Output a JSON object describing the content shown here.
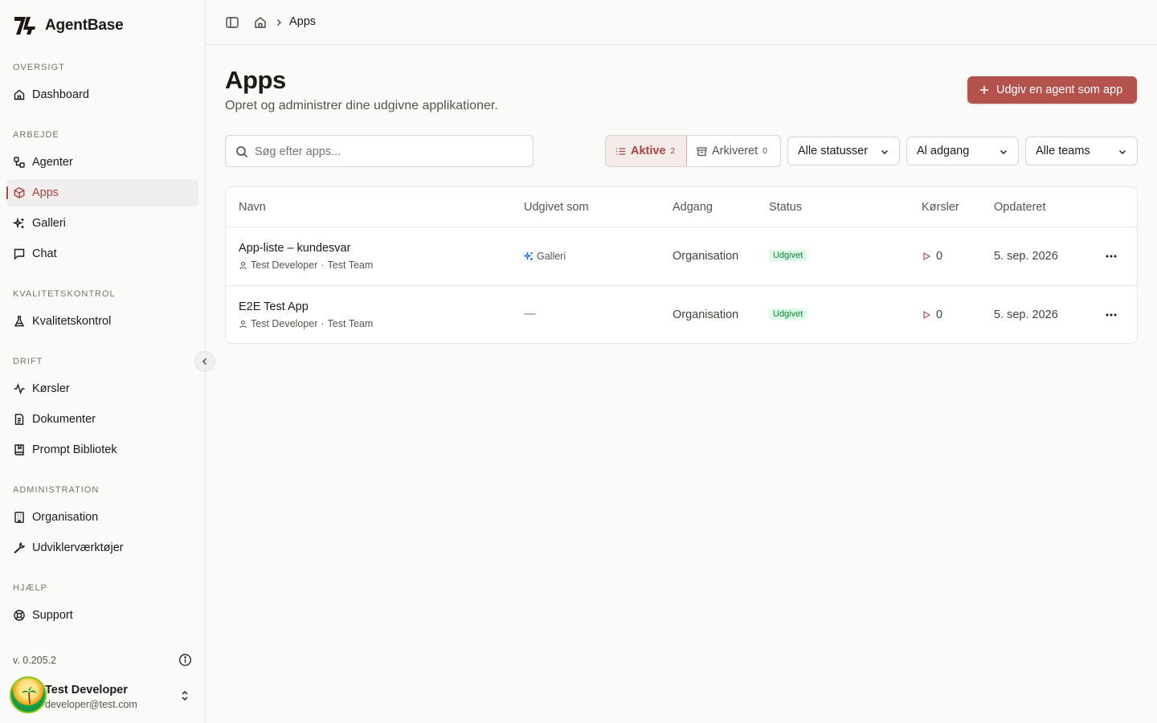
{
  "brand": {
    "name": "AgentBase"
  },
  "sidebar": {
    "sections": [
      {
        "label": "OVERSIGT",
        "items": [
          {
            "label": "Dashboard",
            "icon": "home-icon"
          }
        ]
      },
      {
        "label": "ARBEJDE",
        "items": [
          {
            "label": "Agenter",
            "icon": "workflow-icon"
          },
          {
            "label": "Apps",
            "icon": "box-icon",
            "active": true
          },
          {
            "label": "Galleri",
            "icon": "sparkles-icon"
          },
          {
            "label": "Chat",
            "icon": "message-icon"
          }
        ]
      },
      {
        "label": "KVALITETSKONTROL",
        "items": [
          {
            "label": "Kvalitetskontrol",
            "icon": "flask-icon"
          }
        ]
      },
      {
        "label": "DRIFT",
        "items": [
          {
            "label": "Kørsler",
            "icon": "activity-icon"
          },
          {
            "label": "Dokumenter",
            "icon": "document-icon"
          },
          {
            "label": "Prompt Bibliotek",
            "icon": "book-icon"
          }
        ]
      },
      {
        "label": "ADMINISTRATION",
        "items": [
          {
            "label": "Organisation",
            "icon": "building-icon"
          },
          {
            "label": "Udviklerværktøjer",
            "icon": "wrench-icon"
          }
        ]
      },
      {
        "label": "HJÆLP",
        "items": [
          {
            "label": "Support",
            "icon": "lifebuoy-icon"
          }
        ]
      }
    ],
    "version": "v. 0.205.2",
    "user": {
      "name": "Test Developer",
      "email": "developer@test.com"
    }
  },
  "breadcrumb": {
    "current": "Apps"
  },
  "page": {
    "title": "Apps",
    "subtitle": "Opret og administrer dine udgivne applikationer.",
    "primary_action": "Udgiv en agent som app"
  },
  "filters": {
    "search_placeholder": "Søg efter apps...",
    "tabs": [
      {
        "label": "Aktive",
        "count": "2",
        "selected": true
      },
      {
        "label": "Arkiveret",
        "count": "0",
        "selected": false
      }
    ],
    "status": "Alle statusser",
    "access": "Al adgang",
    "teams": "Alle teams"
  },
  "table": {
    "headers": [
      "Navn",
      "Udgivet som",
      "Adgang",
      "Status",
      "Kørsler",
      "Opdateret"
    ],
    "rows": [
      {
        "name": "App-liste – kundesvar",
        "owner": "Test Developer",
        "team": "Test Team",
        "published_as": "Galleri",
        "access": "Organisation",
        "status": "Udgivet",
        "runs": "0",
        "updated": "5. sep. 2026"
      },
      {
        "name": "E2E Test App",
        "owner": "Test Developer",
        "team": "Test Team",
        "published_as": "—",
        "access": "Organisation",
        "status": "Udgivet",
        "runs": "0",
        "updated": "5. sep. 2026"
      }
    ]
  },
  "colors": {
    "accent": "#a8443f",
    "primary_button": "#b4524e",
    "badge_bg": "#dcfce7",
    "badge_text": "#15803d"
  }
}
